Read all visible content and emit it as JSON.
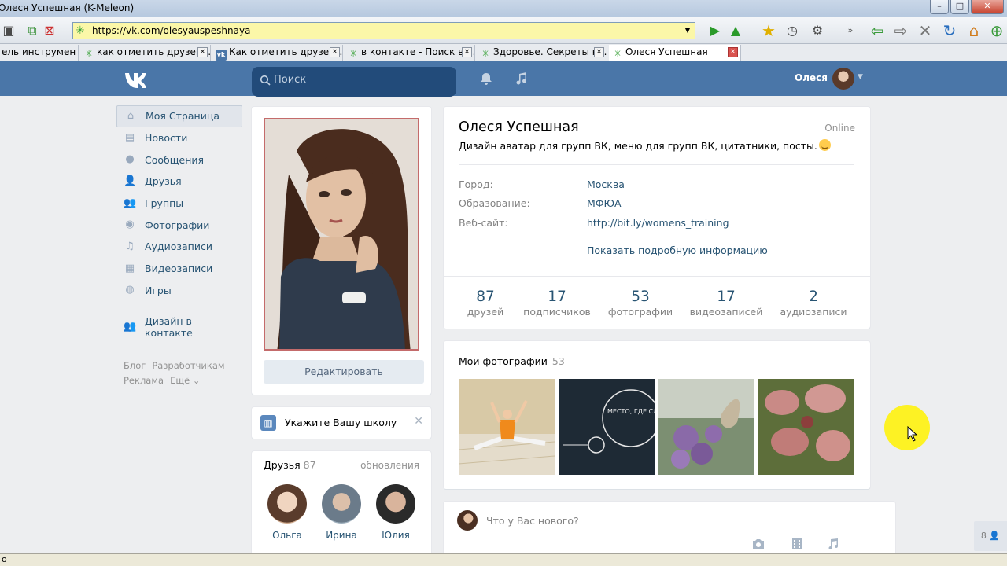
{
  "browser": {
    "title": "Олеся Успешная (K-Meleon)",
    "url": "https://vk.com/olesyauspeshnaya",
    "tabs": [
      {
        "label": "ель инструментов",
        "icon": "none"
      },
      {
        "label": "как отметить друзей ...",
        "icon": "loading"
      },
      {
        "label": "Как отметить друзей ...",
        "icon": "vk"
      },
      {
        "label": "в контакте - Поиск в ...",
        "icon": "loading"
      },
      {
        "label": "Здоровье. Секреты к...",
        "icon": "loading"
      },
      {
        "label": "Олеся Успешная",
        "icon": "loading"
      }
    ],
    "status_text": "о"
  },
  "vk": {
    "logo_text": "VK",
    "search_placeholder": "Поиск",
    "user_name": "Олеся"
  },
  "nav": {
    "items": [
      {
        "label": "Моя Страница",
        "icon": "home-icon"
      },
      {
        "label": "Новости",
        "icon": "news-icon"
      },
      {
        "label": "Сообщения",
        "icon": "messages-icon"
      },
      {
        "label": "Друзья",
        "icon": "friends-icon"
      },
      {
        "label": "Группы",
        "icon": "groups-icon"
      },
      {
        "label": "Фотографии",
        "icon": "camera-icon"
      },
      {
        "label": "Аудиозаписи",
        "icon": "music-icon"
      },
      {
        "label": "Видеозаписи",
        "icon": "video-icon"
      },
      {
        "label": "Игры",
        "icon": "gamepad-icon"
      }
    ],
    "extra": {
      "label": "Дизайн в контакте",
      "icon": "groups-icon"
    },
    "footer": [
      "Блог",
      "Разработчикам",
      "Реклама",
      "Ещё ⌄"
    ]
  },
  "profile": {
    "name": "Олеся Успешная",
    "status": "Дизайн аватар для групп ВК, меню для групп ВК, цитатники, посты.",
    "online": "Online",
    "info": [
      {
        "label": "Город:",
        "value": "Москва"
      },
      {
        "label": "Образование:",
        "value": "МФЮА"
      },
      {
        "label": "Веб-сайт:",
        "value": "http://bit.ly/womens_training"
      }
    ],
    "more_link": "Показать подробную информацию",
    "counters": [
      {
        "num": "87",
        "label": "друзей"
      },
      {
        "num": "17",
        "label": "подписчиков"
      },
      {
        "num": "53",
        "label": "фотографии"
      },
      {
        "num": "17",
        "label": "видеозаписей"
      },
      {
        "num": "2",
        "label": "аудиозаписи"
      }
    ],
    "edit_button": "Редактировать"
  },
  "school": {
    "text": "Укажите Вашу школу"
  },
  "friends": {
    "title": "Друзья",
    "count": "87",
    "updates": "обновления",
    "list": [
      "Ольга",
      "Ирина",
      "Юлия"
    ]
  },
  "photos": {
    "title": "Мои фотографии",
    "count": "53",
    "photo2_text": "МЕСТО, ГДЕ СЛУЧАЮТСЯ ЧУДЕСА"
  },
  "post": {
    "placeholder": "Что у Вас нового?"
  },
  "online_widget": "8"
}
